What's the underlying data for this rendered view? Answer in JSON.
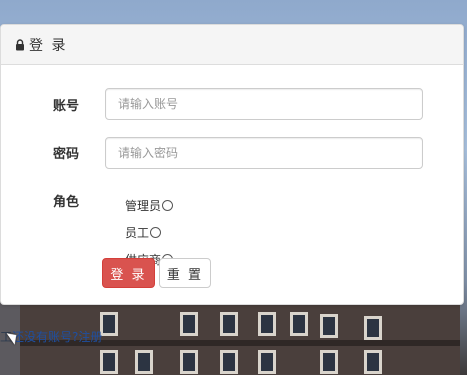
{
  "panel": {
    "title": "登 录",
    "title_icon": "lock-icon"
  },
  "form": {
    "account": {
      "label": "账号",
      "placeholder": "请输入账号",
      "value": ""
    },
    "password": {
      "label": "密码",
      "placeholder": "请输入密码",
      "value": ""
    },
    "role": {
      "label": "角色",
      "options": [
        {
          "label": "管理员",
          "checked": false
        },
        {
          "label": "员工",
          "checked": false
        },
        {
          "label": "供应商",
          "checked": false
        }
      ]
    },
    "buttons": {
      "login": "登 录",
      "reset": "重 置"
    }
  },
  "background": {
    "link_prefix": "工",
    "link_text": "还没有账号?注册"
  },
  "colors": {
    "login_button": "#d9534f",
    "panel_heading": "#f5f5f5"
  }
}
